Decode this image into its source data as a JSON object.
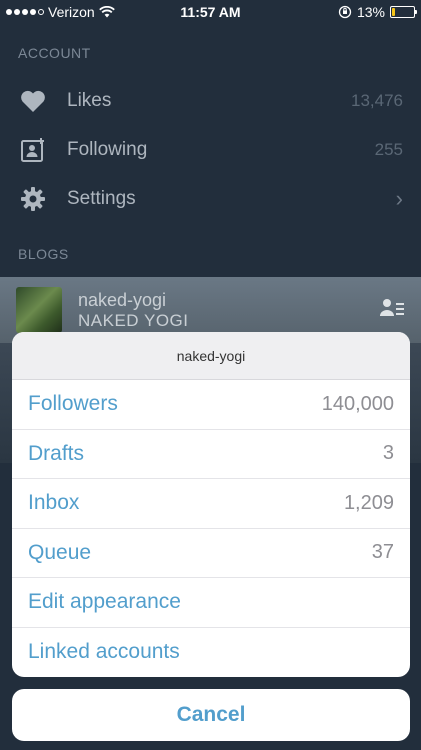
{
  "status": {
    "carrier": "Verizon",
    "time": "11:57 AM",
    "battery": "13%",
    "battery_level": 0.13
  },
  "account": {
    "section_label": "ACCOUNT",
    "items": [
      {
        "label": "Likes",
        "value": "13,476",
        "icon": "heart-icon"
      },
      {
        "label": "Following",
        "value": "255",
        "icon": "following-icon"
      },
      {
        "label": "Settings",
        "value": "",
        "icon": "gear-icon"
      }
    ]
  },
  "blogs": {
    "section_label": "BLOGS",
    "current": {
      "name": "naked-yogi",
      "title": "NAKED YOGI"
    }
  },
  "sheet": {
    "header": "naked-yogi",
    "rows": [
      {
        "label": "Followers",
        "count": "140,000"
      },
      {
        "label": "Drafts",
        "count": "3"
      },
      {
        "label": "Inbox",
        "count": "1,209"
      },
      {
        "label": "Queue",
        "count": "37"
      },
      {
        "label": "Edit appearance",
        "count": ""
      },
      {
        "label": "Linked accounts",
        "count": ""
      }
    ],
    "cancel_label": "Cancel"
  },
  "colors": {
    "accent": "#529ecc",
    "background": "#222e3c"
  }
}
